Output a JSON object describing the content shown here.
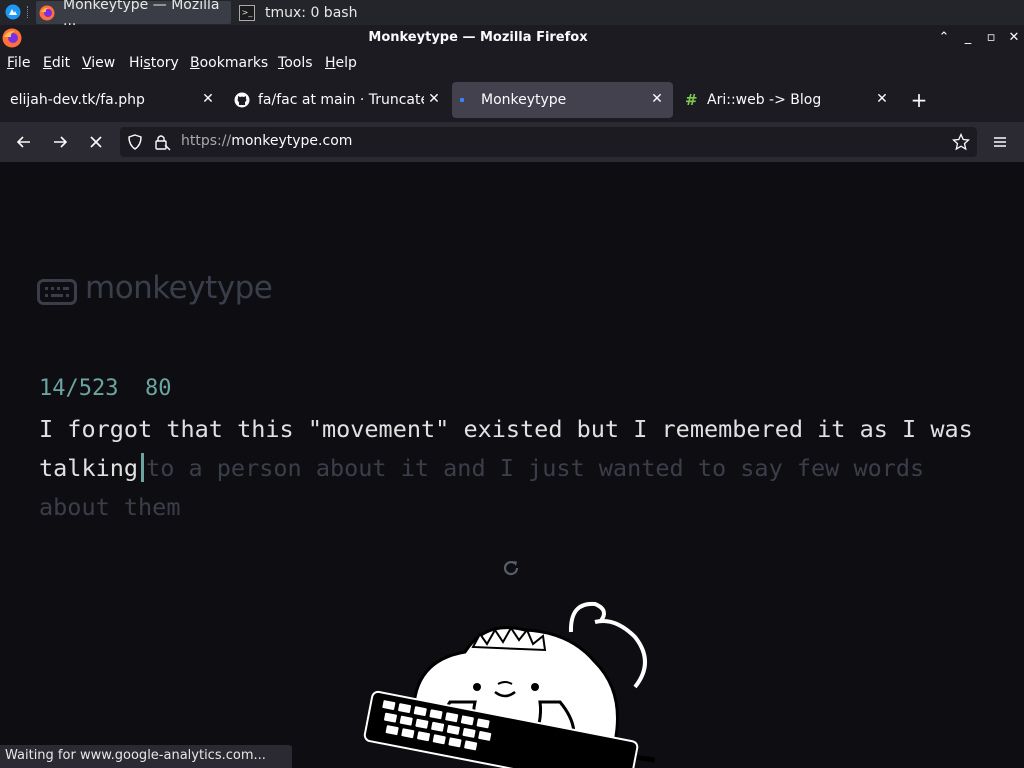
{
  "taskbar": {
    "tasks": [
      {
        "label": "Monkeytype — Mozilla ...",
        "icon": "firefox-icon"
      },
      {
        "label": "tmux: 0 bash",
        "icon": "terminal-icon"
      }
    ]
  },
  "window": {
    "title": "Monkeytype — Mozilla Firefox"
  },
  "menu": [
    "File",
    "Edit",
    "View",
    "History",
    "Bookmarks",
    "Tools",
    "Help"
  ],
  "menu_accel": [
    "F",
    "E",
    "V",
    "s",
    "B",
    "T",
    "H"
  ],
  "tabs": [
    {
      "label": "elijah-dev.tk/fa.php",
      "icon": "none"
    },
    {
      "label": "fa/fac at main · Truncated",
      "icon": "github-icon"
    },
    {
      "label": "Monkeytype",
      "icon": "loading-dot-icon"
    },
    {
      "label": "Ari::web -> Blog",
      "icon": "hash-icon"
    }
  ],
  "url": {
    "scheme": "https://",
    "host": "monkeytype.com"
  },
  "page": {
    "logo": "monkeytype",
    "progress": "14/523",
    "wpm": "80",
    "typed_line1": "I forgot that this \"movement\" existed but I remembered it as I was",
    "typed_word": "talking",
    "remaining": "to a person about it and I just wanted to say few words about them"
  },
  "status": "Waiting for www.google-analytics.com...",
  "colors": {
    "accent": "#6ba4a0",
    "background": "#0e0e12",
    "text": "#e1e1e1",
    "untyped": "#3b3e49"
  }
}
